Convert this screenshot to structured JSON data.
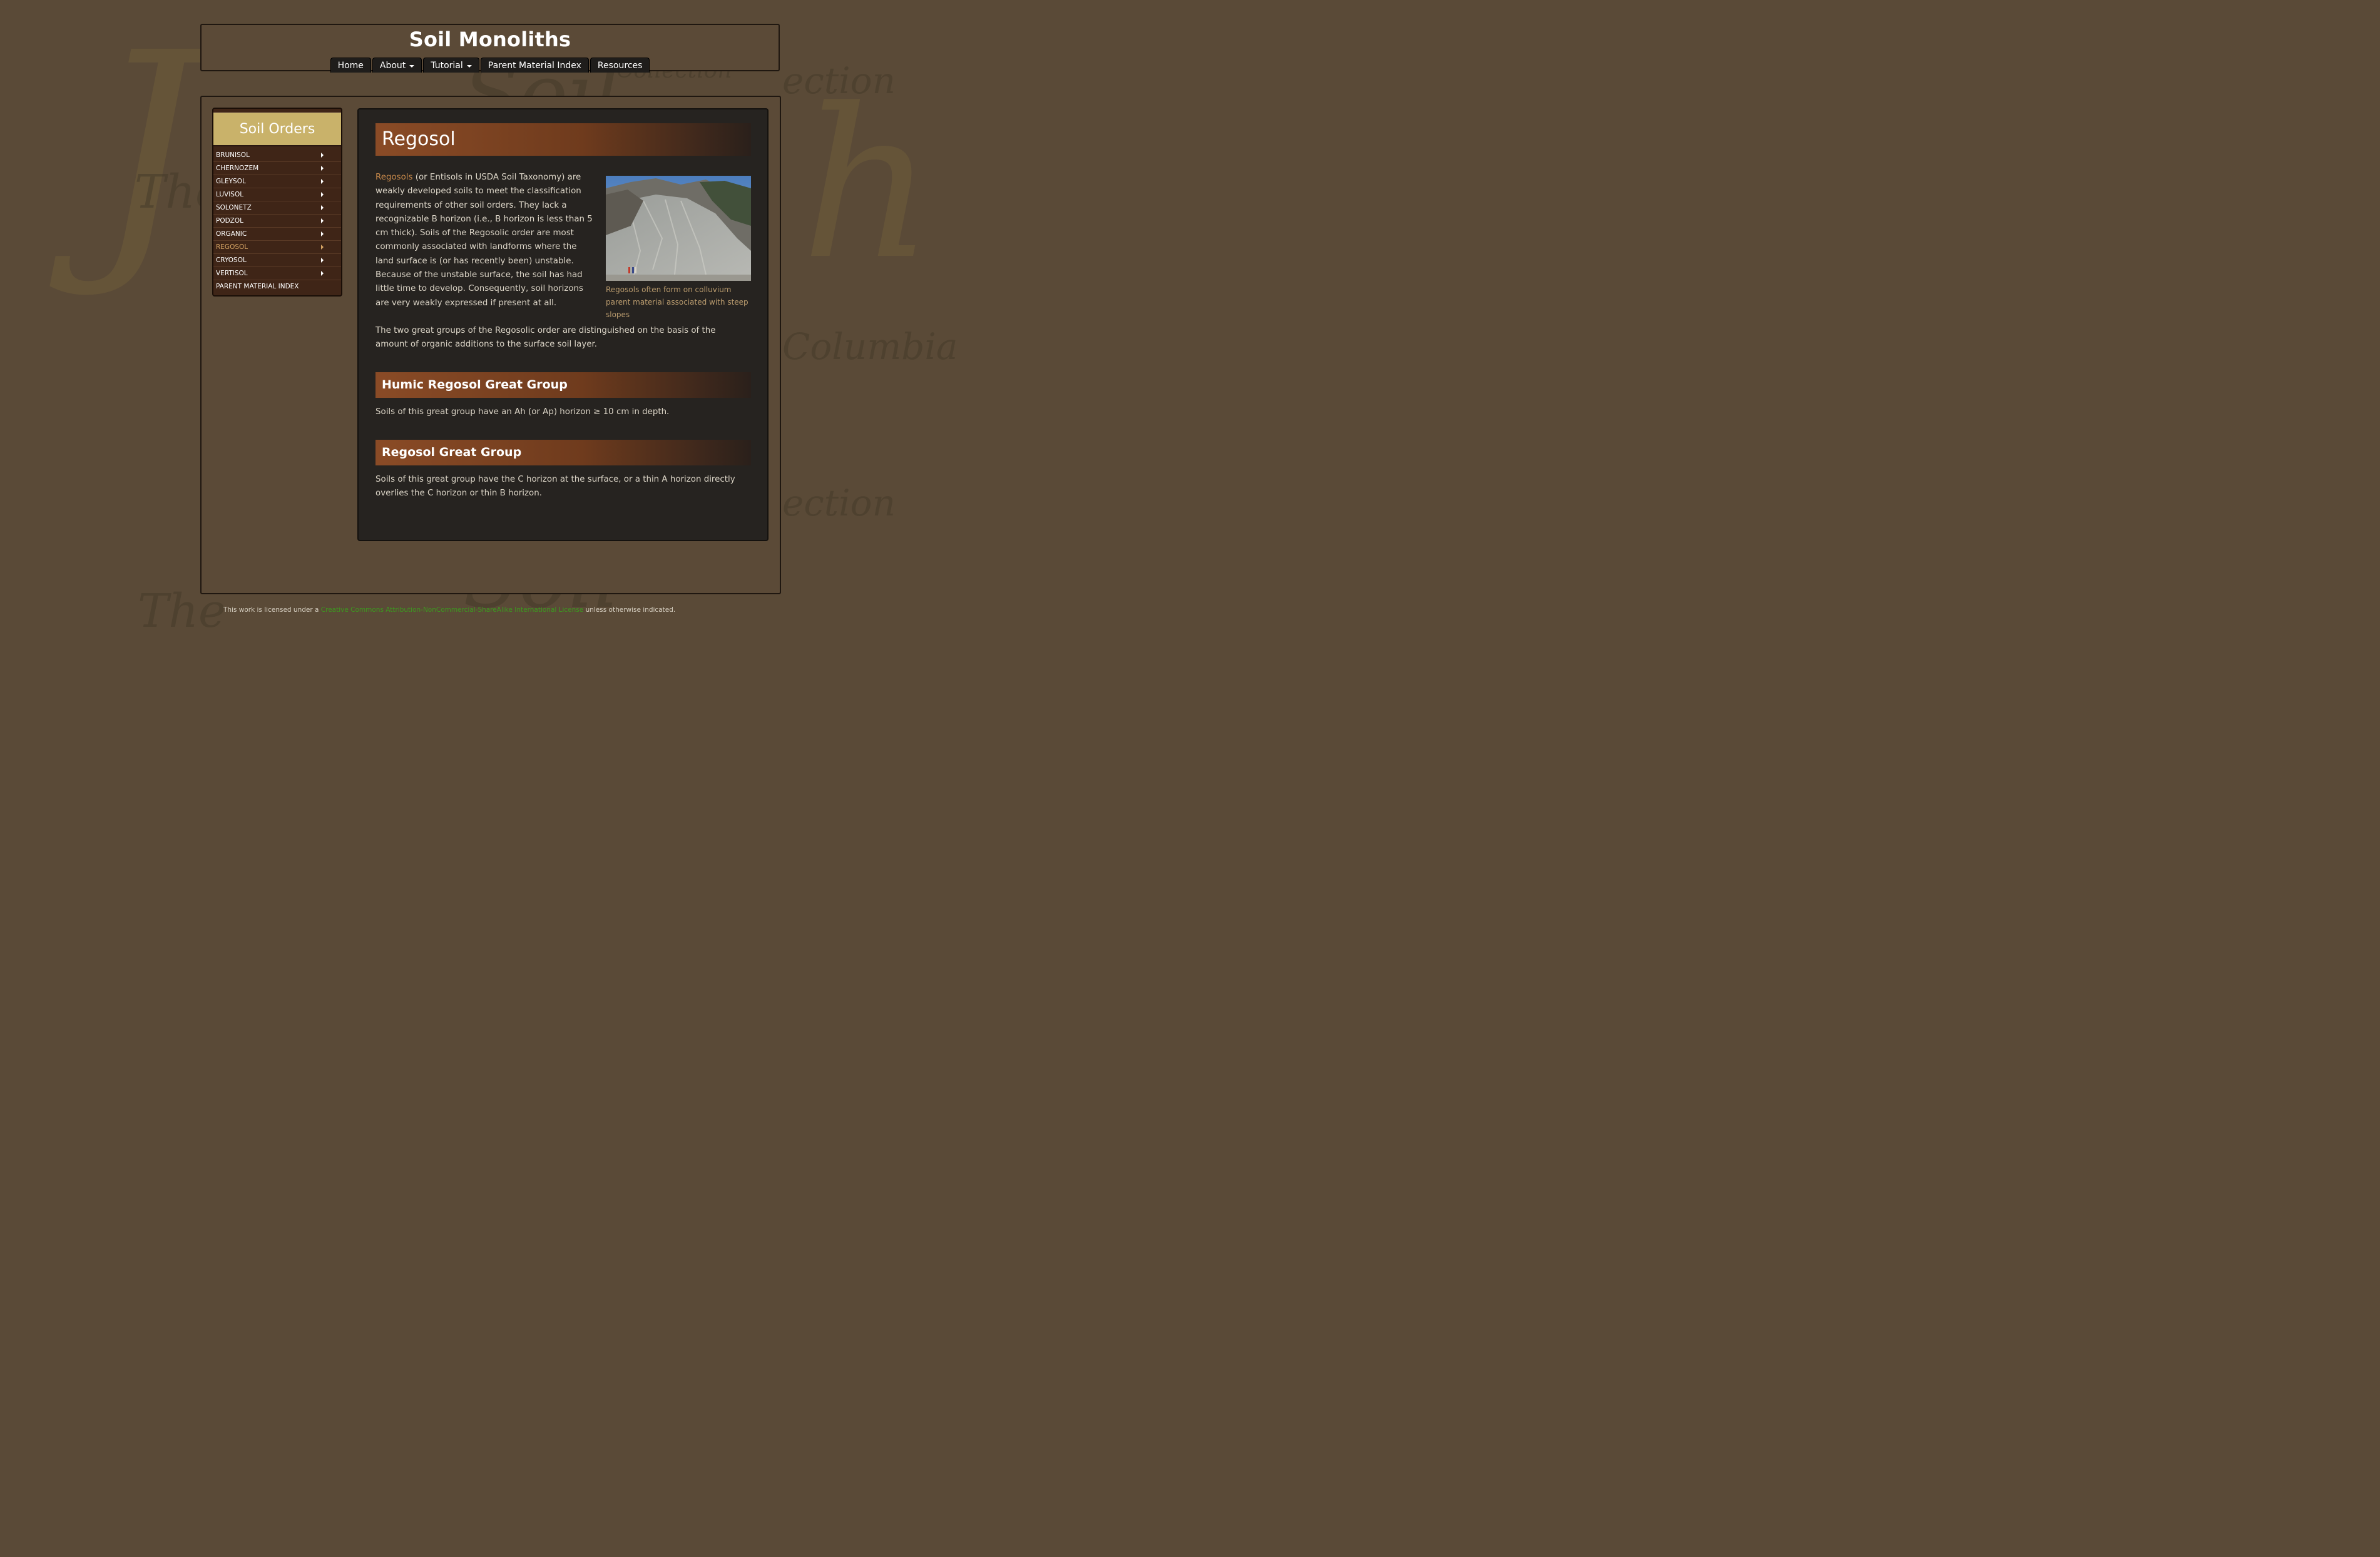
{
  "site": {
    "title": "Soil Monoliths"
  },
  "nav": [
    {
      "label": "Home",
      "dropdown": false
    },
    {
      "label": "About",
      "dropdown": true
    },
    {
      "label": "Tutorial",
      "dropdown": true
    },
    {
      "label": "Parent Material Index",
      "dropdown": false
    },
    {
      "label": "Resources",
      "dropdown": false
    }
  ],
  "sidebar": {
    "heading": "Soil Orders",
    "items": [
      {
        "label": "BRUNISOL"
      },
      {
        "label": "CHERNOZEM"
      },
      {
        "label": "GLEYSOL"
      },
      {
        "label": "LUVISOL"
      },
      {
        "label": "SOLONETZ"
      },
      {
        "label": "PODZOL"
      },
      {
        "label": "ORGANIC"
      },
      {
        "label": "REGOSOL",
        "active": true
      },
      {
        "label": "CRYOSOL"
      },
      {
        "label": "VERTISOL"
      },
      {
        "label": "PARENT MATERIAL INDEX"
      }
    ]
  },
  "main": {
    "title": "Regosol",
    "intro_link": "Regosols",
    "intro_rest": " (or Entisols in USDA Soil Taxonomy) are weakly developed soils to meet the classification requirements of other soil orders. They lack a recognizable B horizon (i.e., B horizon is less than 5 cm thick). Soils of the Regosolic order are most commonly associated with landforms where the land surface is (or has recently been) unstable. Because of the unstable surface, the soil has had little time to develop. Consequently, soil horizons are very weakly expressed if present at all.",
    "para2": "The two great groups of the Regosolic order are distinguished on the basis of the amount of organic additions to the surface soil layer.",
    "figure_caption": "Regosols often form on colluvium parent material associated with steep slopes",
    "sections": [
      {
        "heading": "Humic Regosol Great Group",
        "text": "Soils of this great group have an Ah (or Ap) horizon ≥ 10 cm in depth."
      },
      {
        "heading": "Regosol Great Group",
        "text": "Soils of this great group have the C horizon at the surface, or a thin A horizon directly overlies the C horizon or thin B horizon."
      }
    ]
  },
  "footer": {
    "prefix": "This work is licensed under a ",
    "link": "Creative Commons Attribution-NonCommercial-ShareAlike International License",
    "suffix": " unless otherwise indicated."
  },
  "watermark": [
    "The",
    "Soil",
    "Collection",
    "Columbia",
    "ection"
  ]
}
